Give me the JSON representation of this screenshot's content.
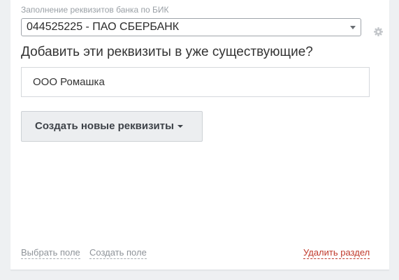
{
  "bik_section": {
    "label": "Заполнение реквизитов банка по БИК",
    "selected_bank": "044525225 - ПАО СБЕРБАНК"
  },
  "merge": {
    "question": "Добавить эти реквизиты в уже существующие?",
    "existing_value": "ООО Ромашка"
  },
  "actions": {
    "create_new_label": "Создать новые реквизиты"
  },
  "footer": {
    "choose_field": "Выбрать поле",
    "create_field": "Создать поле",
    "delete_section": "Удалить раздел"
  },
  "icons": {
    "settings": "gear-icon",
    "dropdown": "chevron-down-icon"
  },
  "colors": {
    "delete_link": "#c0392b",
    "button_bg": "#eceef0"
  }
}
